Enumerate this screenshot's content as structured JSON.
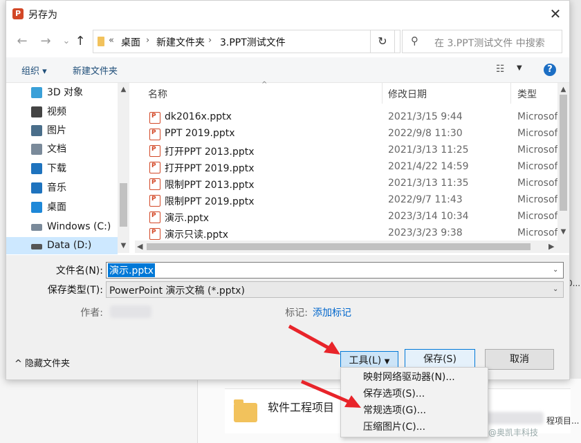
{
  "window": {
    "title": "另存为",
    "app_icon": "P"
  },
  "nav": {
    "back": "←",
    "forward": "→",
    "recent": "⌄",
    "up": "↑",
    "breadcrumb": [
      "桌面",
      "新建文件夹",
      "3.PPT测试文件"
    ],
    "breadcrumb_prefix": "«",
    "refresh": "↻",
    "search_placeholder": "在 3.PPT测试文件 中搜索"
  },
  "toolbar": {
    "organize": "组织 ▾",
    "new_folder": "新建文件夹",
    "view_icon": "☷",
    "view_drop": "▼",
    "help": "?"
  },
  "sidebar": {
    "items": [
      {
        "label": "3D 对象",
        "icon_color": "#3aa0d8"
      },
      {
        "label": "视频",
        "icon_color": "#444444"
      },
      {
        "label": "图片",
        "icon_color": "#4a6e8a"
      },
      {
        "label": "文档",
        "icon_color": "#7a8a9a"
      },
      {
        "label": "下载",
        "icon_color": "#1e73be"
      },
      {
        "label": "音乐",
        "icon_color": "#1e73be"
      },
      {
        "label": "桌面",
        "icon_color": "#1e88d8"
      },
      {
        "label": "Windows (C:)",
        "icon_color": "#7a8a9a"
      },
      {
        "label": "Data (D:)",
        "icon_color": "#555555"
      }
    ]
  },
  "files": {
    "columns": {
      "name": "名称",
      "date": "修改日期",
      "type": "类型"
    },
    "rows": [
      {
        "name": "dk2016x.pptx",
        "date": "2021/3/15 9:44",
        "type": "Microsoft"
      },
      {
        "name": "PPT 2019.pptx",
        "date": "2022/9/8 11:30",
        "type": "Microsoft"
      },
      {
        "name": "打开PPT 2013.pptx",
        "date": "2021/3/13 11:25",
        "type": "Microsoft"
      },
      {
        "name": "打开PPT 2019.pptx",
        "date": "2021/4/22 14:59",
        "type": "Microsoft"
      },
      {
        "name": "限制PPT 2013.pptx",
        "date": "2021/3/13 11:35",
        "type": "Microsoft"
      },
      {
        "name": "限制PPT 2019.pptx",
        "date": "2022/9/7 11:43",
        "type": "Microsoft"
      },
      {
        "name": "演示.pptx",
        "date": "2023/3/14 10:34",
        "type": "Microsoft"
      },
      {
        "name": "演示只读.pptx",
        "date": "2023/3/23 9:38",
        "type": "Microsoft"
      }
    ]
  },
  "form": {
    "filename_label": "文件名(N):",
    "filename_value": "演示.pptx",
    "filetype_label": "保存类型(T):",
    "filetype_value": "PowerPoint 演示文稿 (*.pptx)",
    "author_label": "作者:",
    "tags_label": "标记:",
    "tags_link": "添加标记"
  },
  "footer": {
    "hide_folders": "隐藏文件夹",
    "tools": "工具(L)",
    "save": "保存(S)",
    "cancel": "取消"
  },
  "tools_menu": [
    "映射网络驱动器(N)...",
    "保存选项(S)...",
    "常规选项(G)...",
    "压缩图片(C)..."
  ],
  "background": {
    "folder_label": "软件工程项目",
    "right_text": "程项目...",
    "right_text2": "0...",
    "watermark": "CSDN @奥凯丰科技"
  },
  "colors": {
    "accent": "#0078d7",
    "annotation_arrow": "#e8242a",
    "selection": "#cde8ff"
  }
}
